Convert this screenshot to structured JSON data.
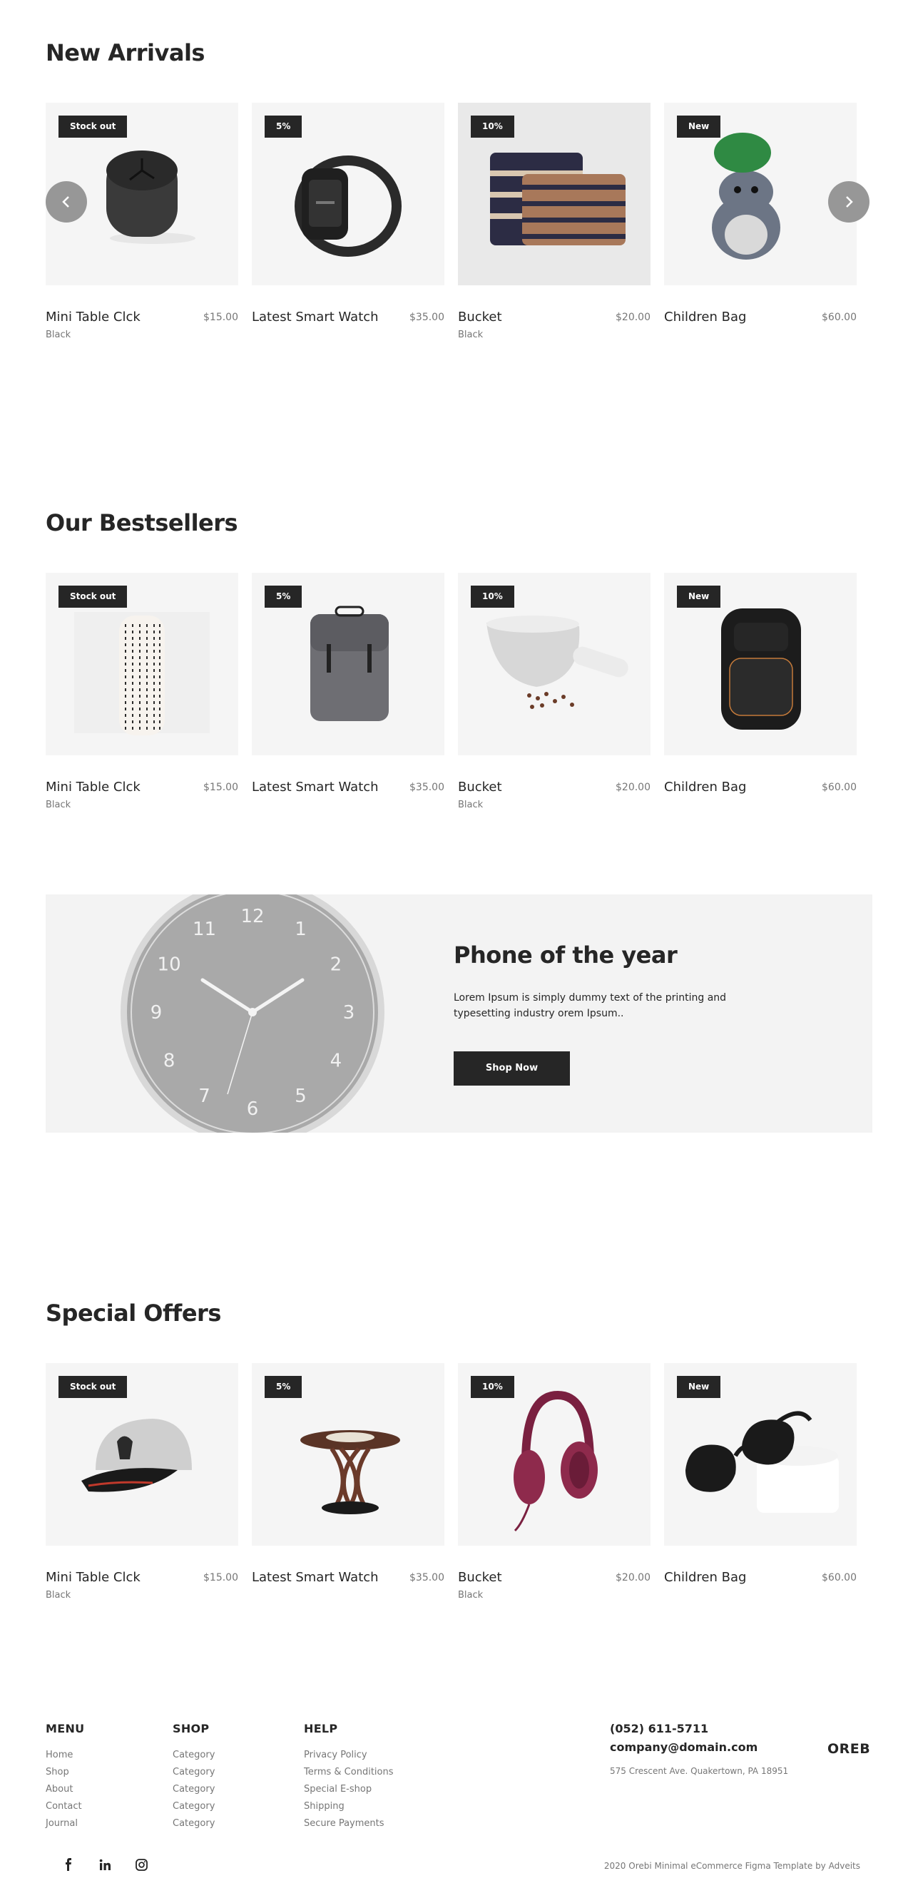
{
  "sections": {
    "new_arrivals": "New Arrivals",
    "bestsellers": "Our Bestsellers",
    "special_offers": "Special Offers"
  },
  "products": [
    {
      "badge": "Stock out",
      "name": "Mini Table Clck",
      "price": "$15.00",
      "color": "Black"
    },
    {
      "badge": "5%",
      "name": "Latest Smart Watch",
      "price": "$35.00",
      "color": ""
    },
    {
      "badge": "10%",
      "name": "Bucket",
      "price": "$20.00",
      "color": "Black"
    },
    {
      "badge": "New",
      "name": "Children Bag",
      "price": "$60.00",
      "color": ""
    }
  ],
  "carousel": {
    "prev_icon": "chevron-left-icon",
    "next_icon": "chevron-right-icon"
  },
  "promo": {
    "title": "Phone of the year",
    "text": "Lorem Ipsum is simply dummy text of the printing and typesetting industry orem Ipsum..",
    "button": "Shop Now",
    "clock_numbers": [
      "12",
      "1",
      "2",
      "3",
      "4",
      "5",
      "6",
      "7",
      "8",
      "9",
      "10",
      "11"
    ]
  },
  "footer": {
    "menu": {
      "title": "MENU",
      "items": [
        "Home",
        "Shop",
        "About",
        "Contact",
        "Journal"
      ]
    },
    "shop": {
      "title": "SHOP",
      "items": [
        "Category",
        "Category",
        "Category",
        "Category",
        "Category"
      ]
    },
    "help": {
      "title": "HELP",
      "items": [
        "Privacy Policy",
        "Terms & Conditions",
        "Special E-shop",
        "Shipping",
        "Secure Payments"
      ]
    },
    "phone": "(052) 611-5711",
    "email": "company@domain.com",
    "address": "575 Crescent Ave. Quakertown, PA 18951",
    "logo": "OREBI",
    "social": [
      "facebook-icon",
      "linkedin-icon",
      "instagram-icon"
    ],
    "copyright": "2020 Orebi Minimal eCommerce Figma Template by Adveits"
  },
  "colors": {
    "dark": "#262626",
    "muted": "#767676",
    "card_bg": "#f5f5f5",
    "promo_bg": "#f3f3f3",
    "arrow": "#979797"
  }
}
